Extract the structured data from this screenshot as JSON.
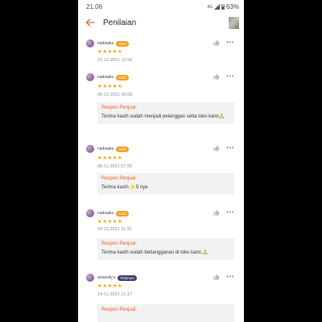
{
  "status": {
    "time": "21.06",
    "signal": "4G",
    "battery": "63%"
  },
  "header": {
    "title": "Penilaian"
  },
  "reviews": [
    {
      "user": "nadiaaku",
      "badge": "Gold",
      "stars": "★★★★★",
      "date": "22-12-2021 12:56"
    },
    {
      "user": "nadiaaku",
      "badge": "Gold",
      "stars": "★★★★★",
      "date": "09-12-2021 06:05",
      "response_label": "Respon Penjual:",
      "response": "Terima kasih sudah menjadi pelanggan setia toko kami🙏"
    },
    {
      "user": "nadiaaku",
      "badge": "Gold",
      "stars": "★★★★★",
      "date": "30-11-2021 07:25",
      "response_label": "Respon Penjual:",
      "response": "Terima kasih ⭐5 nya"
    },
    {
      "user": "nadiaaku",
      "badge": "Gold",
      "stars": "★★★★★",
      "date": "24-11-2021 11:32",
      "response_label": "Respon Penjual:",
      "response": "Terima kasih sudah berlangganan di toko kami.🙏"
    },
    {
      "user": "arisandy.s",
      "badge": "Platinum",
      "stars": "★★★★★",
      "date": "14-11-2021 21:17",
      "response_label": "Respon Penjual:"
    }
  ],
  "colors": {
    "accent": "#e06030",
    "star": "#f6a700",
    "gold_badge": "#f0a020",
    "platinum_badge": "#3d3d6b"
  },
  "icons": {
    "back": "arrow-left-icon",
    "like": "thumbs-up-icon",
    "more": "more-dots-icon"
  }
}
